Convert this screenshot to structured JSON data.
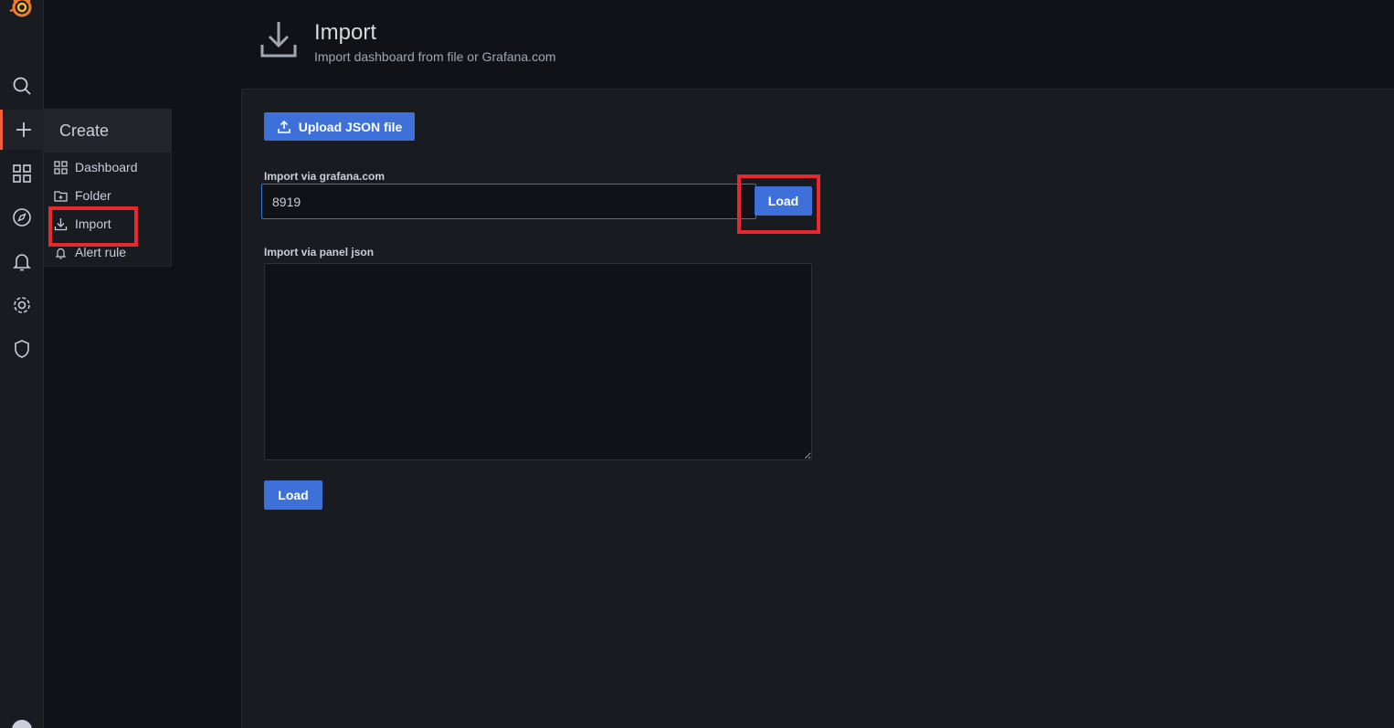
{
  "header": {
    "title": "Import",
    "subtitle": "Import dashboard from file or Grafana.com"
  },
  "create_menu": {
    "title": "Create",
    "items": [
      {
        "label": "Dashboard",
        "icon": "apps-icon"
      },
      {
        "label": "Folder",
        "icon": "folder-plus-icon"
      },
      {
        "label": "Import",
        "icon": "import-icon"
      },
      {
        "label": "Alert rule",
        "icon": "bell-icon"
      }
    ]
  },
  "upload": {
    "label": "Upload JSON file"
  },
  "grafana_import": {
    "label": "Import via grafana.com",
    "value": "8919",
    "button": "Load"
  },
  "panel_json": {
    "label": "Import via panel json",
    "value": "",
    "button": "Load"
  },
  "colors": {
    "accent": "#3d71d9",
    "active_indicator": "#f55f3e",
    "highlight_box": "#e8282f"
  }
}
